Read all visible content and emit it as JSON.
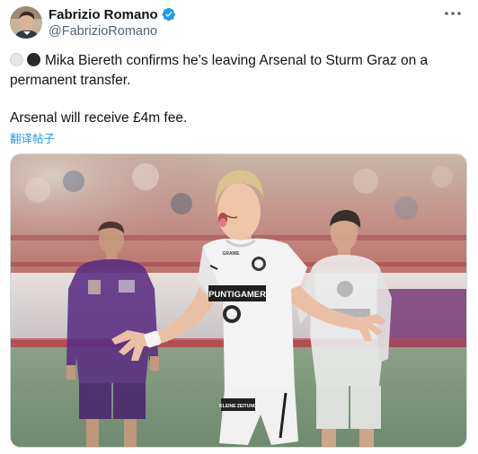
{
  "author": {
    "display_name": "Fabrizio Romano",
    "handle": "@FabrizioRomano"
  },
  "tweet": {
    "line1": "Mika Biereth confirms he’s leaving Arsenal to Sturm Graz on a",
    "line2": "permanent transfer.",
    "line3": "Arsenal will receive £4m fee.",
    "translate_label": "翻译帖子"
  },
  "photo": {
    "sponsor_main": "PUNTIGAMER",
    "sponsor_top": "GRAWE",
    "sponsor_shorts": "KLEINE ZEITUNG"
  },
  "colors": {
    "link": "#1d9bf0",
    "verified": "#1d9bf0",
    "secondary_text": "#536471"
  },
  "icons": [
    "verified-badge-icon",
    "more-options-icon",
    "white-circle-emoji-icon",
    "black-circle-emoji-icon"
  ]
}
